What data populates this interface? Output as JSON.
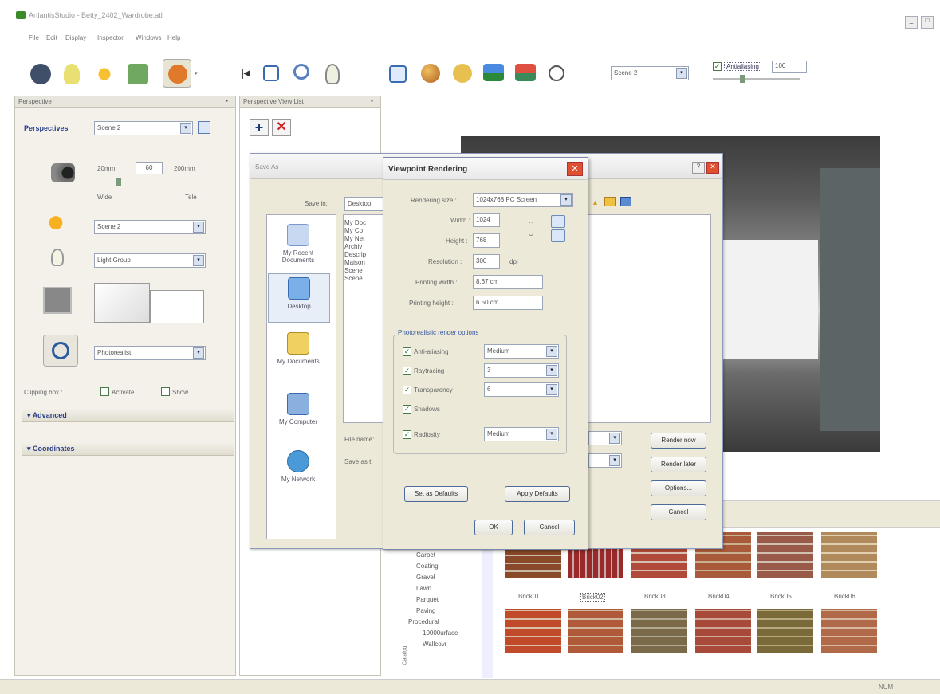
{
  "window": {
    "title": "ArtlantisStudio - Betty_2402_Wardrobe.atl"
  },
  "menu": [
    "File",
    "Edit",
    "Display",
    "Inspector",
    "Windows",
    "Help"
  ],
  "toolbar": {
    "scene_select": "Scene 2",
    "antialias_label": "Antialiasing",
    "antialias_value": "100"
  },
  "perspective_panel": {
    "title": "Perspective",
    "perspectives_label": "Perspectives",
    "perspective_value": "Scene 2",
    "lens_left": "20mm",
    "lens_value": "60",
    "lens_right": "200mm",
    "lens_wide": "Wide",
    "lens_tele": "Tele",
    "sun_value": "Scene 2",
    "light_value": "Light Group",
    "render_value": "Photorealist",
    "clipping_label": "Clipping box :",
    "clip_activate": "Activate",
    "clip_show": "Show",
    "advanced_label": "Advanced",
    "coordinates_label": "Coordinates"
  },
  "view_list": {
    "title": "Perspective View List"
  },
  "save_dialog": {
    "title": "Save As",
    "save_in_label": "Save in:",
    "save_in_value": "Desktop",
    "places": [
      "My Recent Documents",
      "Desktop",
      "My Documents",
      "My Computer",
      "My Network"
    ],
    "files": [
      "My Doc",
      "My Co",
      "My Net",
      "Archiv",
      "Descrip",
      "Maison",
      "Scene",
      "Scene"
    ],
    "filename_label": "File name:",
    "saveas_label": "Save as t",
    "render_now": "Render now",
    "render_later": "Render later",
    "options": "Options...",
    "cancel": "Cancel"
  },
  "render_dialog": {
    "title": "Viewpoint Rendering",
    "size_label": "Rendering size :",
    "size_value": "1024x768 PC Screen",
    "width_label": "Width :",
    "width_value": "1024",
    "height_label": "Height :",
    "height_value": "768",
    "resolution_label": "Resolution :",
    "resolution_value": "300",
    "dpi": "dpi",
    "print_width_label": "Printing width :",
    "print_width_value": "8.67 cm",
    "print_height_label": "Printing height :",
    "print_height_value": "6.50 cm",
    "options_group": "Photorealistic render options",
    "antialias_label": "Anti-aliasing",
    "antialias_value": "Medium",
    "raytracing_label": "Raytracing",
    "raytracing_value": "3",
    "transparency_label": "Transparency",
    "transparency_value": "6",
    "shadows_label": "Shadows",
    "radiosity_label": "Radiosity",
    "radiosity_value": "Medium",
    "set_defaults": "Set as Defaults",
    "apply_defaults": "Apply Defaults",
    "ok": "OK",
    "cancel": "Cancel"
  },
  "catalog": {
    "side_label": "Catalog",
    "tree": [
      "Carpet",
      "Coating",
      "Gravel",
      "Lawn",
      "Parquet",
      "Paving",
      "Procedural",
      "10000urface",
      "Wallcovr"
    ],
    "bricks_row1": [
      "Brick01",
      "Brick02",
      "Brick03",
      "Brick04",
      "Brick05",
      "Brick06"
    ]
  },
  "status": {
    "num": "NUM"
  }
}
